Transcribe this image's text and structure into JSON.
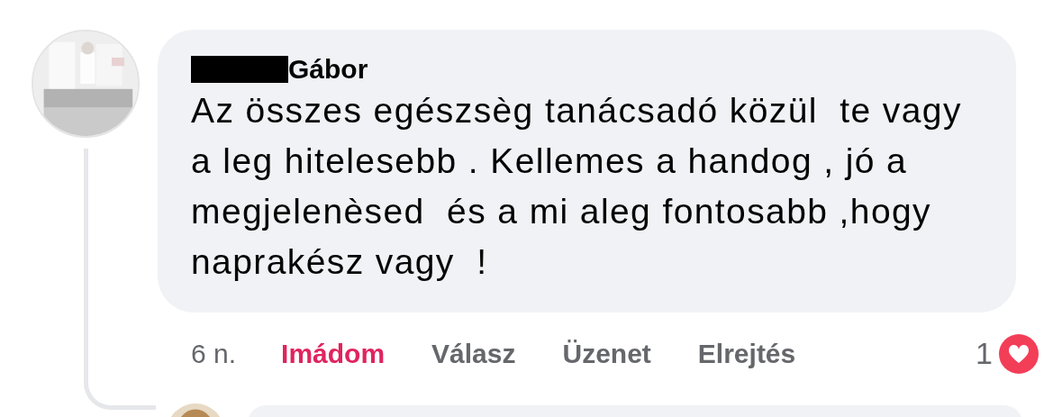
{
  "comment": {
    "author": "Gábor",
    "author_prefix_redacted": true,
    "text": "Az összes egészsèg tanácsadó közül  te vagy a leg hitelesebb . Kellemes a handog , jó a megjelenèsed  és a mi aleg fontosabb ,hogy naprakész vagy  !",
    "time": "6 n.",
    "actions": [
      {
        "label": "Imádom",
        "selected": true
      },
      {
        "label": "Válasz",
        "selected": false
      },
      {
        "label": "Üzenet",
        "selected": false
      },
      {
        "label": "Elrejtés",
        "selected": false
      }
    ],
    "reaction_count": "1"
  }
}
